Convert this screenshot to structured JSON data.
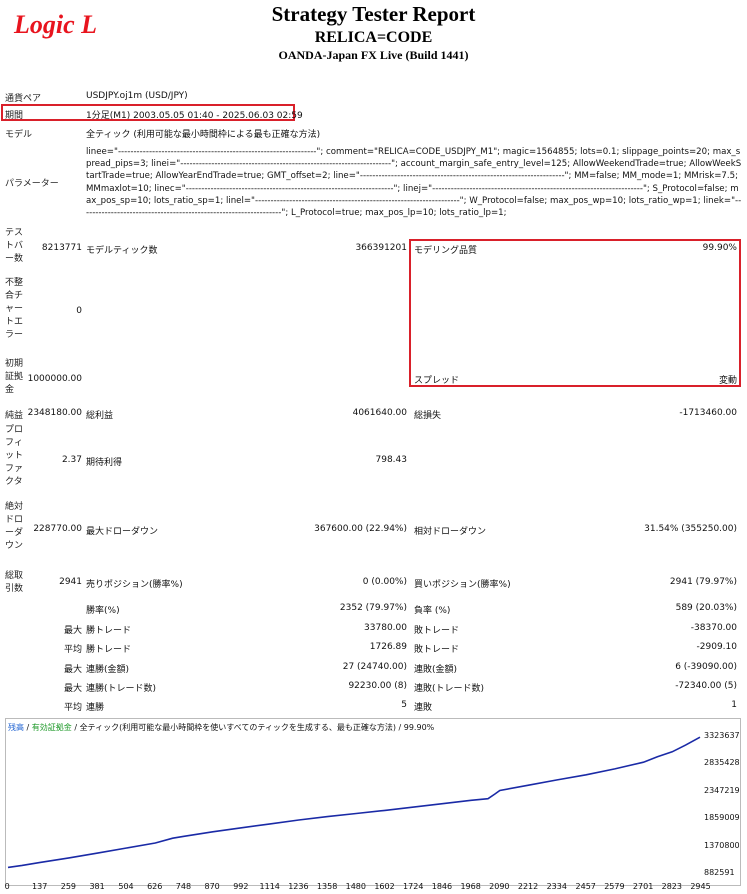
{
  "header": {
    "logo": "Logic L",
    "title": "Strategy Tester Report",
    "ea_name": "RELICA=CODE",
    "broker": "OANDA-Japan FX Live (Build 1441)"
  },
  "info": {
    "symbol_label": "通貨ペア",
    "symbol_value": "USDJPY.oj1m (USD/JPY)",
    "period_label": "期間",
    "period_value": "1分足(M1) 2003.05.05 01:40 - 2025.06.03 02:59",
    "model_label": "モデル",
    "model_value": "全ティック (利用可能な最小時間枠による最も正確な方法)",
    "params_label": "パラメーター",
    "params_value": "linee=\"----------------------------------------------------------------\"; comment=\"RELICA=CODE_USDJPY_M1\"; magic=1564855; lots=0.1; slippage_points=20; max_spread_pips=3; linei=\"--------------------------------------------------------------------\"; account_margin_safe_entry_level=125; AllowWeekendTrade=true; AllowWeekStartTrade=true; AllowYearEndTrade=true; GMT_offset=2; line=\"------------------------------------------------------------------\"; MM=false; MM_mode=1; MMrisk=7.5; MMmaxlot=10; linec=\"-------------------------------------------------------------------\"; linej=\"--------------------------------------------------------------------\"; S_Protocol=false; max_pos_sp=10; lots_ratio_sp=1; linel=\"------------------------------------------------------------------\"; W_Protocol=false; max_pos_wp=10; lots_ratio_wp=1; linek=\"-----------------------------------------------------------------\"; L_Protocol=true; max_pos_lp=10; lots_ratio_lp=1;"
  },
  "stats": {
    "bars_label": "テストバー数",
    "bars_value": "8213771",
    "ticks_label": "モデルティック数",
    "ticks_value": "366391201",
    "quality_label": "モデリング品質",
    "quality_value": "99.90%",
    "mismatch_label": "不整合チャートエラー",
    "mismatch_value": "0",
    "deposit_label": "初期証拠金",
    "deposit_value": "1000000.00",
    "spread_label": "スプレッド",
    "spread_value": "変動",
    "net_label": "純益",
    "net_value": "2348180.00",
    "gross_profit_label": "総利益",
    "gross_profit_value": "4061640.00",
    "gross_loss_label": "総損失",
    "gross_loss_value": "-1713460.00",
    "pf_label": "プロフィットファクタ",
    "pf_value": "2.37",
    "expected_label": "期待利得",
    "expected_value": "798.43",
    "abs_dd_label": "絶対ドローダウン",
    "abs_dd_value": "228770.00",
    "max_dd_label": "最大ドローダウン",
    "max_dd_value": "367600.00 (22.94%)",
    "rel_dd_label": "相対ドローダウン",
    "rel_dd_value": "31.54% (355250.00)",
    "trades_label": "総取引数",
    "trades_value": "2941",
    "short_label": "売りポジション(勝率%)",
    "short_value": "0 (0.00%)",
    "long_label": "買いポジション(勝率%)",
    "long_value": "2941 (79.97%)",
    "winrate_label": "勝率(%)",
    "winrate_value": "2352 (79.97%)",
    "lossrate_label": "負率 (%)",
    "lossrate_value": "589 (20.03%)",
    "max_pre": "最大",
    "avg_pre": "平均",
    "best_label": "勝トレード",
    "best_value": "33780.00",
    "worst_label": "敗トレード",
    "worst_value": "-38370.00",
    "avg_win_label": "勝トレード",
    "avg_win_value": "1726.89",
    "avg_loss_label": "敗トレード",
    "avg_loss_value": "-2909.10",
    "cons_win_money_label": "連勝(金額)",
    "cons_win_money_value": "27 (24740.00)",
    "cons_loss_money_label": "連敗(金額)",
    "cons_loss_money_value": "6 (-39090.00)",
    "cons_win_count_label": "連勝(トレード数)",
    "cons_win_count_value": "92230.00 (8)",
    "cons_loss_count_label": "連敗(トレード数)",
    "cons_loss_count_value": "-72340.00 (5)",
    "avg_cons_win_label": "連勝",
    "avg_cons_win_value": "5",
    "avg_cons_loss_label": "連敗",
    "avg_cons_loss_value": "1"
  },
  "chart_data": {
    "type": "line",
    "legend_balance": "残高",
    "legend_sep": " / ",
    "legend_equity": "有効証拠金",
    "legend_model": "全ティック(利用可能な最小時間枠を使いすべてのティックを生成する、最も正確な方法)",
    "legend_quality": "99.90%",
    "colors": {
      "balance": "#1a2aa6",
      "legend_balance": "#1a5fd1",
      "legend_equity": "#1f9a2a"
    },
    "x_ticks": [
      "0",
      "137",
      "259",
      "381",
      "504",
      "626",
      "748",
      "870",
      "992",
      "1114",
      "1236",
      "1358",
      "1480",
      "1602",
      "1724",
      "1846",
      "1968",
      "2090",
      "2212",
      "2334",
      "2457",
      "2579",
      "2701",
      "2823",
      "2945"
    ],
    "y_ticks": [
      "3323637",
      "2835428",
      "2347219",
      "1859009",
      "1370800",
      "882591"
    ],
    "xlim": [
      0,
      2941
    ],
    "ylim": [
      882591,
      3323637
    ],
    "x": [
      0,
      60,
      137,
      259,
      381,
      504,
      626,
      700,
      748,
      870,
      992,
      1114,
      1236,
      1358,
      1480,
      1602,
      1724,
      1846,
      1968,
      2040,
      2070,
      2090,
      2212,
      2334,
      2457,
      2579,
      2701,
      2760,
      2823,
      2880,
      2941
    ],
    "y": [
      1000000,
      1035000,
      1090000,
      1170000,
      1255000,
      1345000,
      1435000,
      1520000,
      1555000,
      1635000,
      1705000,
      1775000,
      1845000,
      1905000,
      1960000,
      2015000,
      2075000,
      2135000,
      2195000,
      2225000,
      2310000,
      2370000,
      2465000,
      2560000,
      2650000,
      2755000,
      2875000,
      2970000,
      3060000,
      3180000,
      3320000
    ]
  }
}
